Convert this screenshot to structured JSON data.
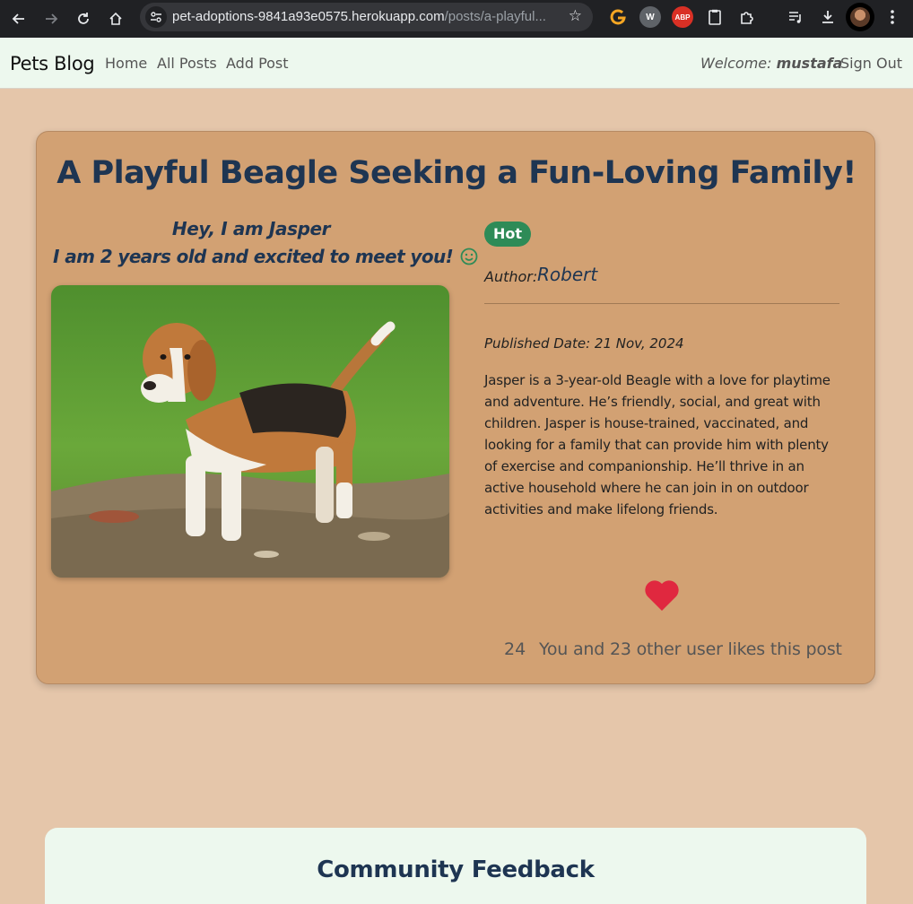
{
  "browser": {
    "url_host": "pet-adoptions-9841a93e0575.herokuapp.com",
    "url_path": "/posts/a-playful..."
  },
  "navbar": {
    "brand": "Pets Blog",
    "links": [
      "Home",
      "All Posts",
      "Add Post"
    ],
    "welcome_label": "Welcome:",
    "username": "mustafa",
    "signout": "Sign Out"
  },
  "post": {
    "title": "A Playful Beagle Seeking a Fun-Loving Family!",
    "intro_line1": "Hey, I am Jasper",
    "intro_line2": "I am 2 years old and excited to meet you!",
    "badge": "Hot",
    "author_label": "Author:",
    "author": "Robert",
    "published": "Published Date: 21 Nov, 2024",
    "description": "Jasper is a 3-year-old Beagle with a love for playtime and adventure. He’s friendly, social, and great with children. Jasper is house-trained, vaccinated, and looking for a family that can provide him with plenty of exercise and companionship. He’ll thrive in an active household where he can join in on outdoor activities and make lifelong friends.",
    "likes_count": "24",
    "likes_text": "You and 23 other user likes this post",
    "heart_color": "#e0283f",
    "badge_color": "#2e8b57"
  },
  "feedback": {
    "title": "Community Feedback"
  }
}
